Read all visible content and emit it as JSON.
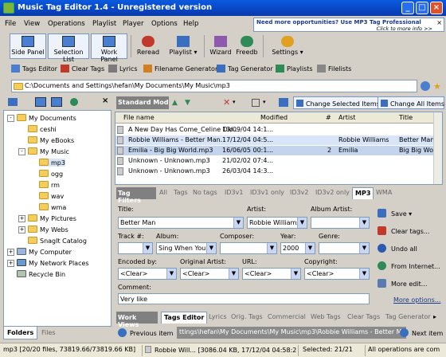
{
  "window": {
    "title": "Music Tag Editor 1.4 - Unregistered version"
  },
  "ad": {
    "line1": "Need more opportunities? Use MP3 Tag Professional",
    "line2": "Click to more info >>",
    "close": "×"
  },
  "menu": [
    "File",
    "View",
    "Operations",
    "Playlist",
    "Player",
    "Options",
    "Help"
  ],
  "toolbar": {
    "side_panel": "Side Panel",
    "selection_list": "Selection List",
    "work_panel": "Work Panel",
    "reread": "Reread",
    "playlist": "Playlist",
    "wizard": "Wizard",
    "freedb": "Freedb",
    "settings": "Settings"
  },
  "toolbar2": [
    "Tags Editor",
    "Clear Tags",
    "Lyrics",
    "Filename Generator",
    "Tag Generator",
    "Playlists",
    "Filelists"
  ],
  "path": "C:\\Documents and Settings\\hefan\\My Documents\\My Music\\mp3",
  "tree": {
    "my_documents": "My Documents",
    "ceshi": "ceshi",
    "my_ebooks": "My eBooks",
    "my_music": "My Music",
    "mp3": "mp3",
    "ogg": "ogg",
    "rm": "rm",
    "wav": "wav",
    "wma": "wma",
    "my_pictures": "My Pictures",
    "my_webs": "My Webs",
    "snagit": "SnagIt Catalog",
    "my_computer": "My Computer",
    "network": "My Network Places",
    "recycle": "Recycle Bin"
  },
  "left_tabs": {
    "folders": "Folders",
    "files": "Files"
  },
  "filelist_toolbar": {
    "mode": "Standard Mod",
    "change_selected": "Change Selected Items",
    "change_all": "Change All Items"
  },
  "files": {
    "headers": {
      "name": "File name",
      "modified": "Modified",
      "num": "#",
      "artist": "Artist",
      "title": "Title"
    },
    "rows": [
      {
        "name": "A New Day Has Come_Celine Dio...",
        "modified": "13/09/04 14:1...",
        "num": "",
        "artist": "",
        "title": ""
      },
      {
        "name": "Robbie Williams - Better Man.mp3",
        "modified": "17/12/04 04:5...",
        "num": "",
        "artist": "Robbie Williams",
        "title": "Better Man"
      },
      {
        "name": "Emilia - Big Big World.mp3",
        "modified": "16/06/05 00:1...",
        "num": "2",
        "artist": "Emilia",
        "title": "Big Big World"
      },
      {
        "name": "Unknown - Unknown.mp3",
        "modified": "21/02/02 07:4...",
        "num": "",
        "artist": "",
        "title": ""
      },
      {
        "name": "Unknown - Unknown.mp3",
        "modified": "26/03/04 14:3...",
        "num": "",
        "artist": "",
        "title": ""
      }
    ]
  },
  "tag_tabs": {
    "filters": "Tag Filters",
    "items": [
      "All",
      "Tags",
      "No tags",
      "ID3v1",
      "ID3v1 only",
      "ID3v2",
      "ID3v2 only",
      "MP3",
      "WMA"
    ]
  },
  "editor": {
    "title_label": "Title:",
    "title_value": "Better Man",
    "artist_label": "Artist:",
    "artist_value": "Robbie Williams",
    "album_artist_label": "Album Artist:",
    "album_artist_value": "",
    "track_label": "Track #:",
    "track_value": "",
    "album_label": "Album:",
    "album_value": "Sing When You'r",
    "composer_label": "Composer:",
    "composer_value": "",
    "year_label": "Year:",
    "year_value": "2000",
    "genre_label": "Genre:",
    "genre_value": "",
    "encoded_label": "Encoded by:",
    "encoded_value": "<Clear>",
    "orig_artist_label": "Original Artist:",
    "orig_artist_value": "<Clear>",
    "url_label": "URL:",
    "url_value": "<Clear>",
    "copyright_label": "Copyright:",
    "copyright_value": "<Clear>",
    "comment_label": "Comment:",
    "comment_value": "Very like"
  },
  "actions": {
    "save": "Save",
    "clear_tags": "Clear tags...",
    "undo_all": "Undo all",
    "from_internet": "From Internet...",
    "more_edit": "More edit...",
    "more_options": "More options..."
  },
  "bottom_tabs": {
    "work_views": "Work Views",
    "items": [
      "Tags Editor",
      "Lyrics",
      "Orig. Tags",
      "Commercial",
      "Web Tags",
      "Clear Tags",
      "Tag Generator"
    ]
  },
  "nav": {
    "previous": "Previous item",
    "next": "Next item",
    "path": "ttings\\hefan\\My Documents\\My Music\\mp3\\Robbie Williams - Better Man.mp3"
  },
  "status": {
    "summary": "mp3 [20/20 files, 73819.66/73819.66 KB]",
    "current": "Robbie Will... [3086.04 KB, 17/12/04 04:58:24]",
    "selected": "Selected: 21/21",
    "ops": "All operations are com"
  }
}
